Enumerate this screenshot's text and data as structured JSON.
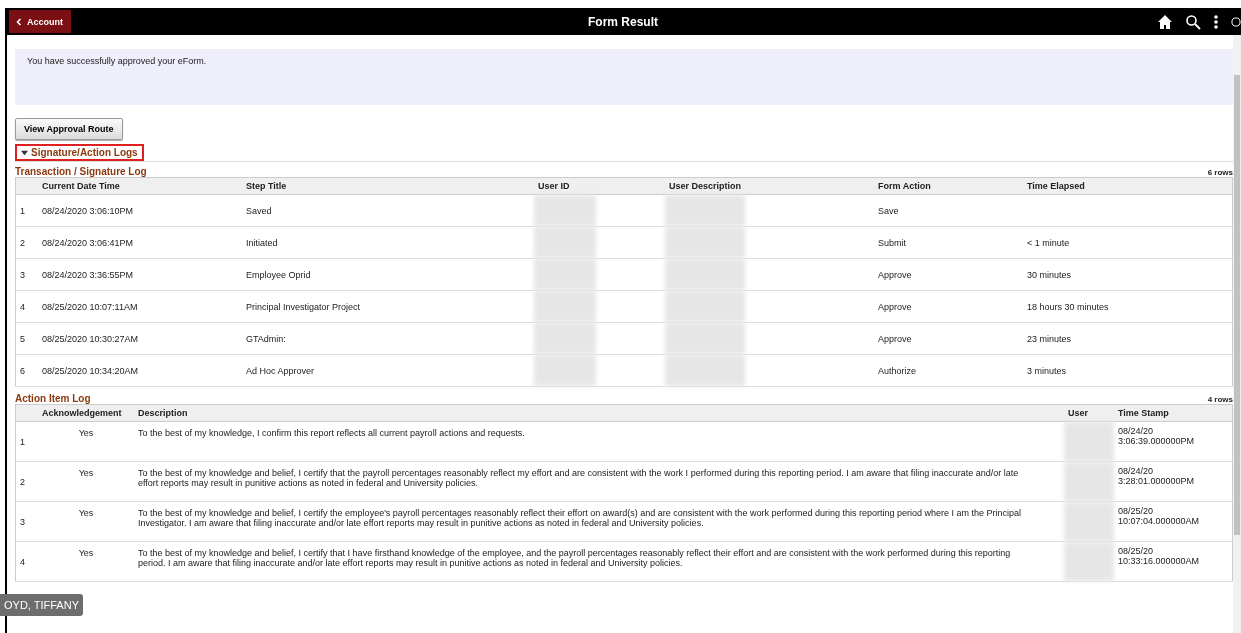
{
  "header": {
    "back_button": "Account",
    "title": "Form Result"
  },
  "message": "You have successfully approved your eForm.",
  "approval_button": "View Approval Route",
  "section": {
    "label": "Signature/Action Logs",
    "expanded": true
  },
  "transaction_log": {
    "title": "Transaction / Signature Log",
    "row_count": "6 rows",
    "columns": [
      "Current Date Time",
      "Step Title",
      "User ID",
      "User Description",
      "Form Action",
      "Time Elapsed"
    ],
    "rows": [
      {
        "number": "1",
        "date_time": "08/24/2020  3:06:10PM",
        "step_title": "Saved",
        "form_action": "Save"
      },
      {
        "number": "2",
        "date_time": "08/24/2020  3:06:41PM",
        "step_title": "Initiated",
        "form_action": "Submit",
        "time_elapsed": "< 1 minute"
      },
      {
        "number": "3",
        "date_time": "08/24/2020  3:36:55PM",
        "step_title": "Employee Oprid",
        "form_action": "Approve",
        "time_elapsed": "30 minutes"
      },
      {
        "number": "4",
        "date_time": "08/25/2020 10:07:11AM",
        "step_title": "Principal Investigator Project",
        "form_action": "Approve",
        "time_elapsed": "18 hours 30 minutes"
      },
      {
        "number": "5",
        "date_time": "08/25/2020 10:30:27AM",
        "step_title": "GTAdmin:",
        "form_action": "Approve",
        "time_elapsed": "23 minutes"
      },
      {
        "number": "6",
        "date_time": "08/25/2020 10:34:20AM",
        "step_title": "Ad Hoc Approver",
        "form_action": "Authorize",
        "time_elapsed": "3 minutes"
      }
    ]
  },
  "action_log": {
    "title": "Action Item Log",
    "row_count": "4 rows",
    "columns": [
      "Acknowledgement",
      "Description",
      "User",
      "Time Stamp"
    ],
    "rows": [
      {
        "number": "1",
        "acknowledgement": "Yes",
        "description": "To the best of my knowledge, I confirm this report reflects all current payroll actions and requests.",
        "date": "08/24/20",
        "time": "3:06:39.000000PM"
      },
      {
        "number": "2",
        "acknowledgement": "Yes",
        "description": "To the best of my knowledge and belief, I certify that the payroll percentages reasonably reflect my effort and are consistent with the work I performed during this reporting period.  I am aware that filing inaccurate and/or late effort reports may result in punitive actions as noted in federal and University policies.",
        "date": "08/24/20",
        "time": "3:28:01.000000PM"
      },
      {
        "number": "3",
        "acknowledgement": "Yes",
        "description": "To the best of my knowledge and belief, I certify the employee's payroll percentages reasonably reflect their effort on award(s) and are consistent with the work performed during this reporting period where I am the Principal Investigator.  I am aware that filing inaccurate and/or late effort reports may result in punitive actions as noted in federal and University policies.",
        "date": "08/25/20",
        "time": "10:07:04.000000AM"
      },
      {
        "number": "4",
        "acknowledgement": "Yes",
        "description": "To the best of my knowledge and belief, I certify that I have firsthand knowledge of the employee, and the payroll percentages reasonably reflect their effort and are consistent with the work performed during this reporting period.  I am aware that filing inaccurate and/or late effort reports may result in punitive actions as noted in federal and University policies.",
        "date": "08/25/20",
        "time": "10:33:16.000000AM"
      }
    ]
  },
  "name_tag": "OYD, TIFFANY"
}
